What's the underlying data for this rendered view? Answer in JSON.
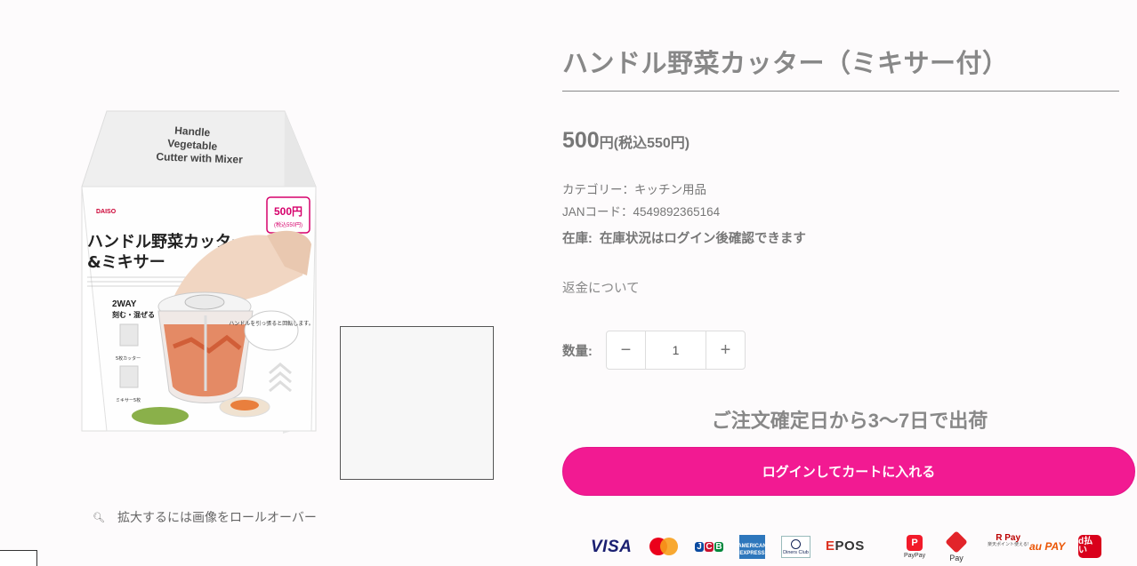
{
  "product": {
    "title": "ハンドル野菜カッター（ミキサー付）",
    "price_amount": "500",
    "price_unit": "円",
    "price_tax": "(税込550円)",
    "category": "カテゴリー：キッチン用品",
    "jan": "JANコード：4549892365164",
    "stock_label": "在庫:",
    "stock_text": "在庫状況はログイン後確認できます",
    "refund_link": "返金について",
    "quantity_label": "数量:",
    "quantity_value": "1",
    "minus_symbol": "−",
    "plus_symbol": "+",
    "shipping_note": "ご注文確定日から3〜7日で出荷",
    "cart_button": "ログインしてカートに入れる"
  },
  "gallery": {
    "zoom_hint": "拡大するには画像をロールオーバー",
    "zoom_icon": "magnifier-icon",
    "box_art": {
      "title_en_1": "Handle",
      "title_en_2": "Vegetable",
      "title_en_3": "Cutter with Mixer",
      "brand": "DAISO",
      "price_main": "500円",
      "price_tax": "(税込550円)",
      "title_jp_1": "ハンドル野菜カッター",
      "title_jp_2": "&ミキサー",
      "tag_2way": "2WAY",
      "tag_2way_sub": "刻む・混ぜる",
      "bubble": "ハンドルを引っ張ると回転します。",
      "side_label": "5枚カッター",
      "side_label_2": "ミキサー5枚"
    }
  },
  "payments": {
    "visa": "VISA",
    "jcb": [
      "J",
      "C",
      "B"
    ],
    "amex": "AMERICAN EXPRESS",
    "diners": "Diners Club",
    "epos_e": "E",
    "epos_rest": "POS",
    "paypay": "PayPay",
    "paypay_logo": "P",
    "mpay": "Pay",
    "rpay": "R Pay",
    "rpay_sub": "楽天ポイント使える!",
    "aupay": "au PAY",
    "dbarai": "d払い"
  },
  "colors": {
    "accent": "#f21a92",
    "text": "#888888"
  }
}
